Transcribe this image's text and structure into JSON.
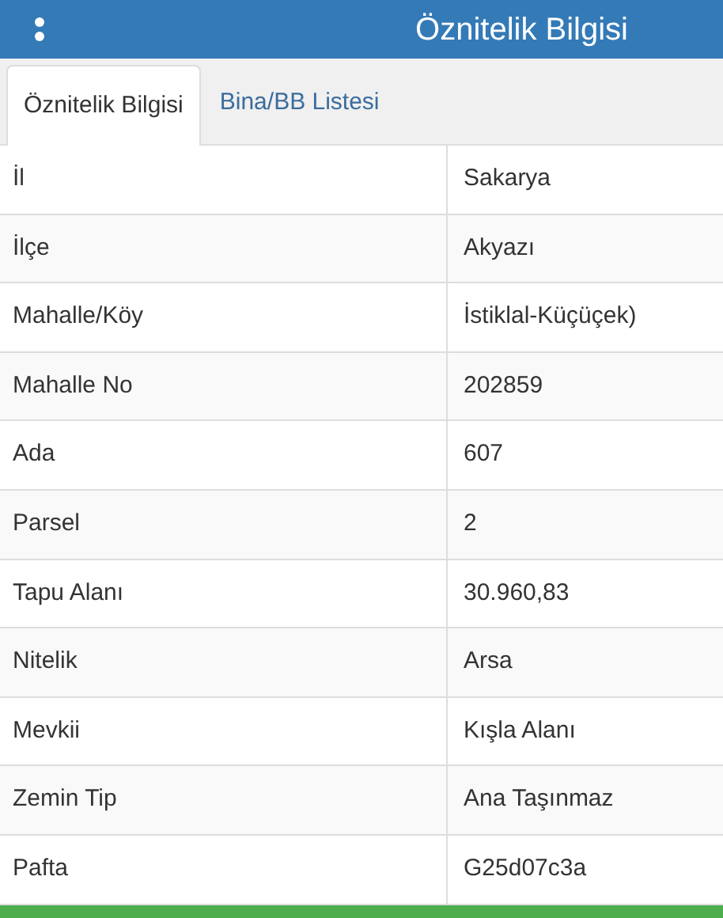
{
  "header": {
    "title": "Öznitelik Bilgisi"
  },
  "tabs": [
    {
      "label": "Öznitelik Bilgisi",
      "selected": true
    },
    {
      "label": "Bina/BB Listesi",
      "selected": false
    }
  ],
  "table": {
    "rows": [
      {
        "label": "İl",
        "value": "Sakarya"
      },
      {
        "label": "İlçe",
        "value": "Akyazı"
      },
      {
        "label": "Mahalle/Köy",
        "value": "İstiklal-Küçüçek)"
      },
      {
        "label": "Mahalle No",
        "value": "202859"
      },
      {
        "label": "Ada",
        "value": "607"
      },
      {
        "label": "Parsel",
        "value": "2"
      },
      {
        "label": "Tapu Alanı",
        "value": "30.960,83"
      },
      {
        "label": "Nitelik",
        "value": "Arsa"
      },
      {
        "label": "Mevkii",
        "value": "Kışla Alanı"
      },
      {
        "label": "Zemin Tip",
        "value": "Ana Taşınmaz"
      },
      {
        "label": "Pafta",
        "value": "G25d07c3a"
      }
    ]
  }
}
